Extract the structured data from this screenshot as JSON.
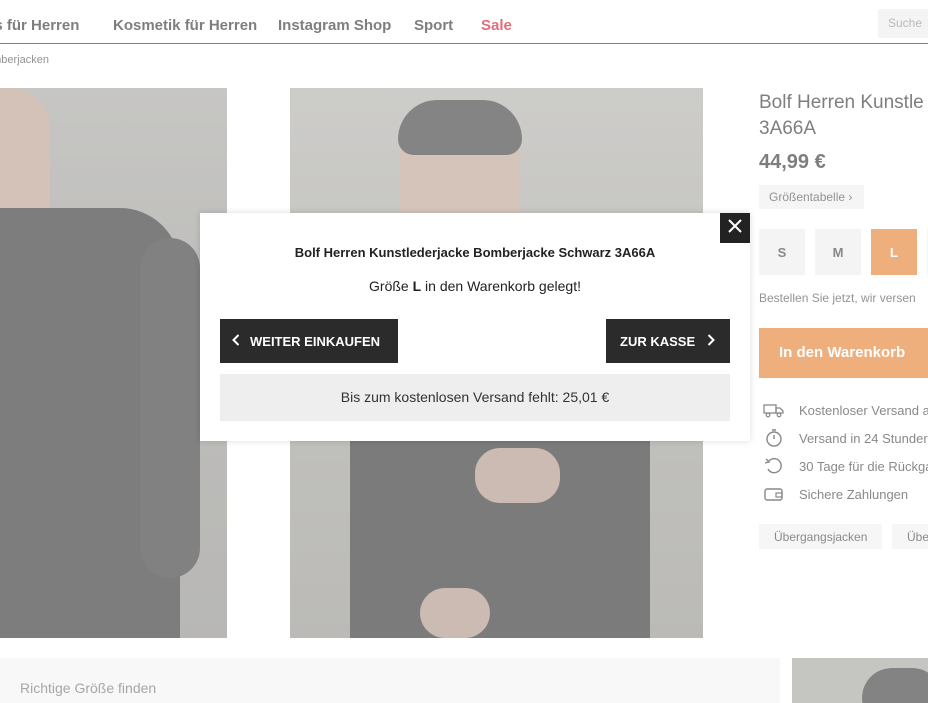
{
  "nav": {
    "items": [
      {
        "label": "es für Herren"
      },
      {
        "label": "Kosmetik für Herren"
      },
      {
        "label": "Instagram Shop"
      },
      {
        "label": "Sport"
      },
      {
        "label": "Sale"
      }
    ],
    "search_placeholder": "Suche"
  },
  "breadcrumb": "omberjacken",
  "product": {
    "title": "Bolf Herren Kunstlederjacke Bomberjacke Schwarz 3A66A",
    "title_visible": "Bolf Herren Kunstle 3A66A",
    "price": "44,99 €",
    "size_chart_label": "Größentabelle ›",
    "sizes": [
      {
        "label": "S",
        "selected": false
      },
      {
        "label": "M",
        "selected": false
      },
      {
        "label": "L",
        "selected": true
      }
    ],
    "order_note": "Bestellen Sie jetzt, wir versen",
    "add_to_cart_label": "In den Warenkorb",
    "benefits": [
      {
        "icon": "truck-icon",
        "text": "Kostenloser Versand a"
      },
      {
        "icon": "stopwatch-icon",
        "text": "Versand in 24 Stunder"
      },
      {
        "icon": "return-arrow-icon",
        "text": "30 Tage für die Rückga"
      },
      {
        "icon": "wallet-icon",
        "text": "Sichere Zahlungen"
      }
    ],
    "tags": [
      "Übergangsjacken",
      "Übe"
    ]
  },
  "bottom": {
    "size_finder_label": "Richtige Größe finden"
  },
  "modal": {
    "title": "Bolf Herren Kunstlederjacke Bomberjacke Schwarz 3A66A",
    "msg_prefix": "Größe ",
    "msg_size": "L",
    "msg_suffix": " in den Warenkorb gelegt!",
    "continue_label": "WEITER EINKAUFEN",
    "checkout_label": "ZUR KASSE",
    "shipping_text": "Bis zum kostenlosen Versand fehlt: 25,01 €"
  },
  "colors": {
    "accent": "#e2751f",
    "sale": "#d0021b",
    "dark_button": "#2b2b2b"
  }
}
